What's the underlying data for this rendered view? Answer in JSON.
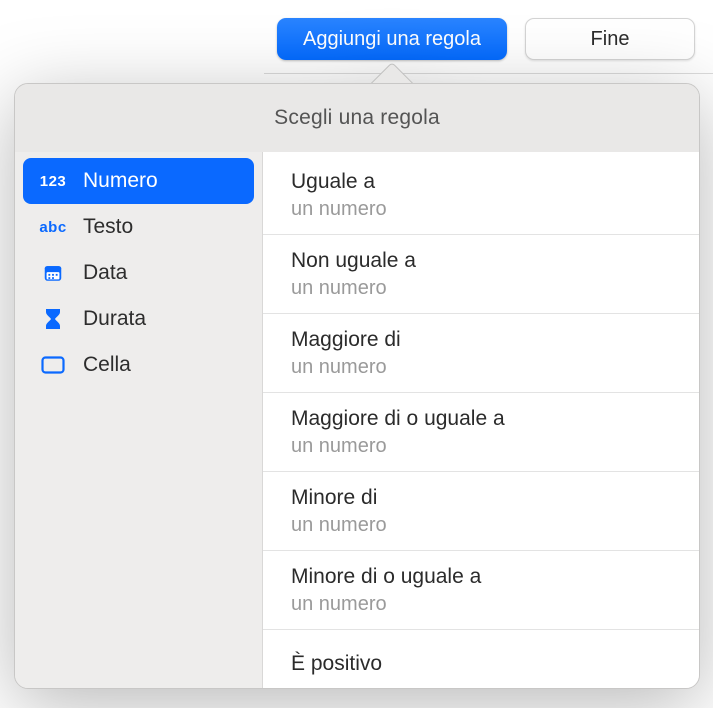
{
  "toolbar": {
    "add_rule_label": "Aggiungi una regola",
    "done_label": "Fine"
  },
  "popover": {
    "title": "Scegli una regola"
  },
  "sidebar": {
    "items": [
      {
        "id": "number",
        "label": "Numero",
        "icon": "123",
        "selected": true
      },
      {
        "id": "text",
        "label": "Testo",
        "icon": "abc",
        "selected": false
      },
      {
        "id": "date",
        "label": "Data",
        "icon": "calendar",
        "selected": false
      },
      {
        "id": "duration",
        "label": "Durata",
        "icon": "hourglass",
        "selected": false
      },
      {
        "id": "cell",
        "label": "Cella",
        "icon": "cell",
        "selected": false
      }
    ]
  },
  "rules": [
    {
      "title": "Uguale a",
      "sub": "un numero"
    },
    {
      "title": "Non uguale a",
      "sub": "un numero"
    },
    {
      "title": "Maggiore di",
      "sub": "un numero"
    },
    {
      "title": "Maggiore di o uguale a",
      "sub": "un numero"
    },
    {
      "title": "Minore di",
      "sub": "un numero"
    },
    {
      "title": "Minore di o uguale a",
      "sub": "un numero"
    },
    {
      "title": "È positivo",
      "sub": ""
    }
  ]
}
